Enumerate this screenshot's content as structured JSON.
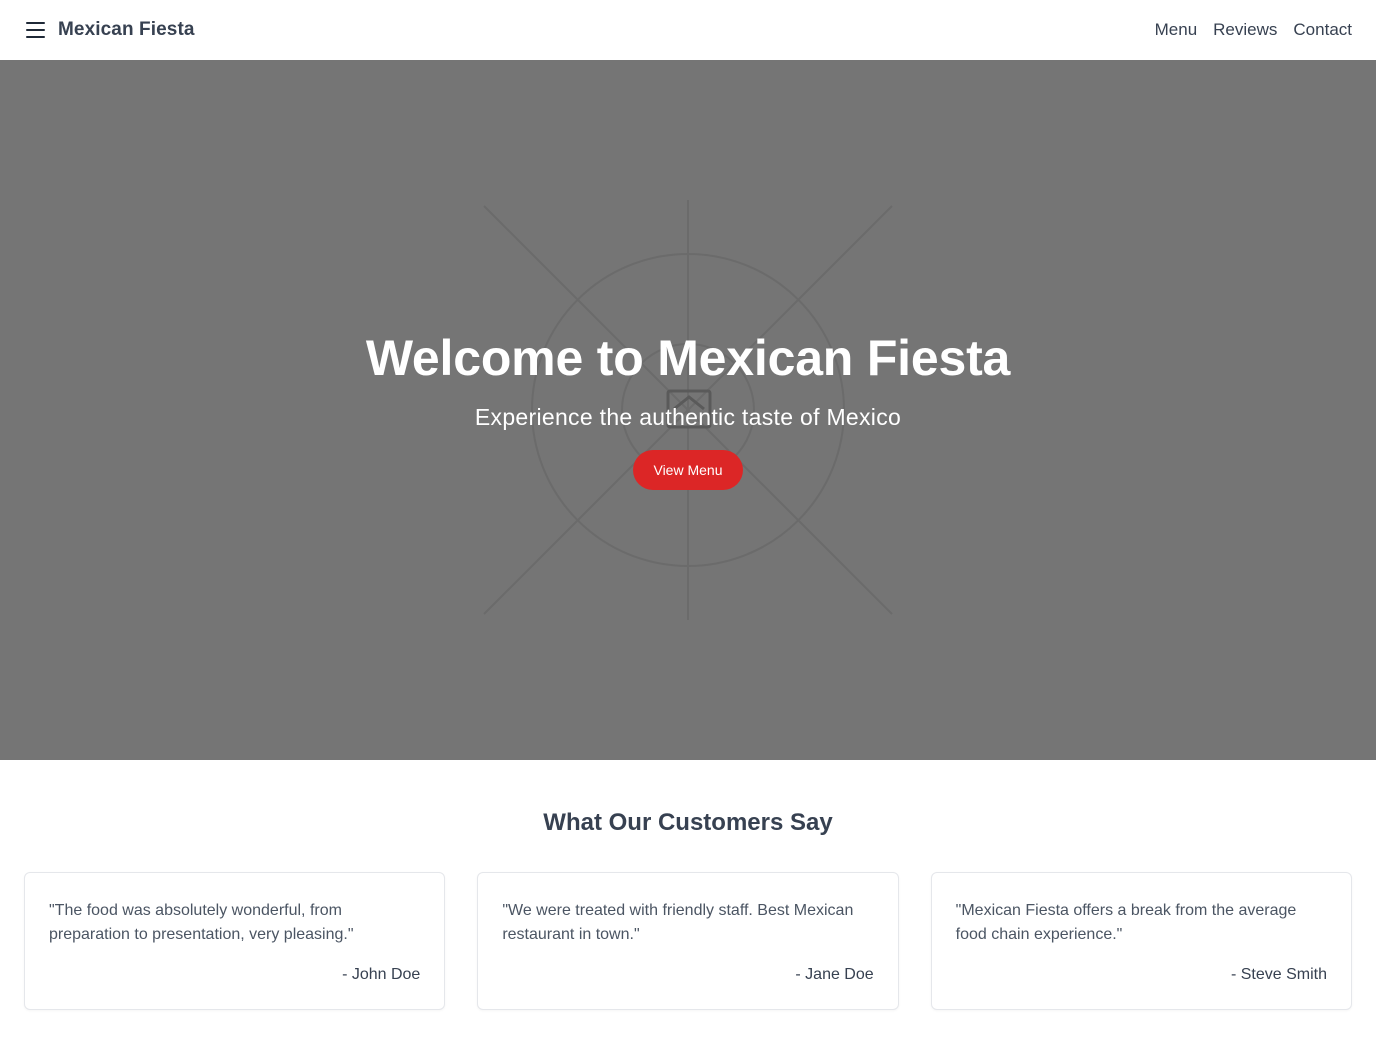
{
  "header": {
    "brand": "Mexican Fiesta",
    "nav": [
      {
        "label": "Menu"
      },
      {
        "label": "Reviews"
      },
      {
        "label": "Contact"
      }
    ]
  },
  "hero": {
    "title": "Welcome to Mexican Fiesta",
    "subtitle": "Experience the authentic taste of Mexico",
    "button_label": "View Menu",
    "button_color": "#dc2626",
    "background_color": "#757575",
    "image_icon": "image-placeholder-icon"
  },
  "reviews": {
    "title": "What Our Customers Say",
    "items": [
      {
        "quote": "\"The food was absolutely wonderful, from preparation to presentation, very pleasing.\"",
        "author": "- John Doe"
      },
      {
        "quote": "\"We were treated with friendly staff. Best Mexican restaurant in town.\"",
        "author": "- Jane Doe"
      },
      {
        "quote": "\"Mexican Fiesta offers a break from the average food chain experience.\"",
        "author": "- Steve Smith"
      }
    ]
  }
}
